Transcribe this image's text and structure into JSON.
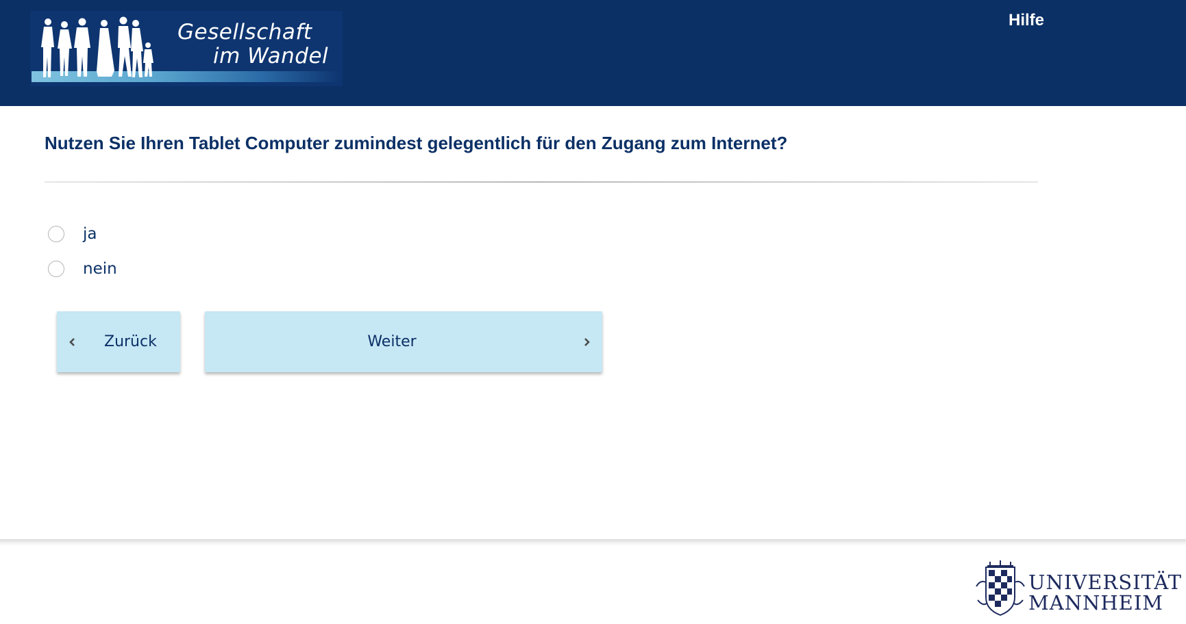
{
  "header": {
    "logo": {
      "line1": "Gesellschaft",
      "line2": "im Wandel"
    },
    "help_label": "Hilfe"
  },
  "question": {
    "text": "Nutzen Sie Ihren Tablet Computer zumindest gelegentlich für den Zugang zum Internet?",
    "options": [
      {
        "label": "ja",
        "selected": false
      },
      {
        "label": "nein",
        "selected": false
      }
    ]
  },
  "navigation": {
    "back_label": "Zurück",
    "next_label": "Weiter"
  },
  "footer": {
    "logo": {
      "line1": "UNIVERSITÄT",
      "line2": "MANNHEIM"
    }
  },
  "colors": {
    "header_bg": "#0b3066",
    "button_bg": "#c6e7f4",
    "text_primary": "#0b3066"
  },
  "icons": [
    "chevron-left-icon",
    "chevron-right-icon",
    "people-silhouette-icon",
    "university-crest-icon"
  ]
}
